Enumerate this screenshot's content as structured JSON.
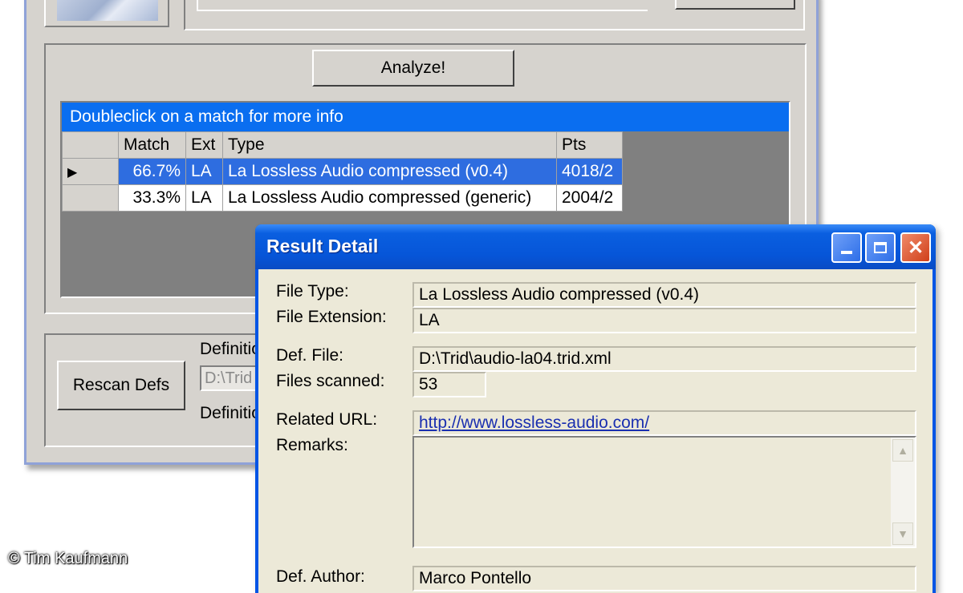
{
  "main": {
    "analyze_button": "Analyze!",
    "results_caption": "Doubleclick on a match for more info",
    "columns": [
      "Match",
      "Ext",
      "Type",
      "Pts"
    ],
    "rows": [
      {
        "match": "66.7%",
        "ext": "LA",
        "type": "La Lossless Audio compressed (v0.4)",
        "pts": "4018/2",
        "selected": true
      },
      {
        "match": "33.3%",
        "ext": "LA",
        "type": "La Lossless Audio compressed (generic)",
        "pts": "2004/2",
        "selected": false
      }
    ],
    "rescan_button": "Rescan Defs",
    "defs_label_top": "Definitio",
    "defs_path_value": "D:\\Trid",
    "defs_label_bottom": "Definitio"
  },
  "dialog": {
    "title": "Result Detail",
    "file_type_label": "File Type:",
    "file_type_value": "La Lossless Audio compressed (v0.4)",
    "file_ext_label": "File Extension:",
    "file_ext_value": "LA",
    "def_file_label": "Def. File:",
    "def_file_value": "D:\\Trid\\audio-la04.trid.xml",
    "files_scanned_label": "Files scanned:",
    "files_scanned_value": "53",
    "related_url_label": "Related URL:",
    "related_url_value": "http://www.lossless-audio.com/",
    "remarks_label": "Remarks:",
    "def_author_label": "Def. Author:",
    "def_author_value": "Marco Pontello"
  },
  "credit": "© Tim Kaufmann",
  "colors": {
    "results_header": "#0a6ef0",
    "selected_row": "#2e6de0",
    "dialog_title": "#0655d8",
    "close_button": "#d0401a"
  }
}
